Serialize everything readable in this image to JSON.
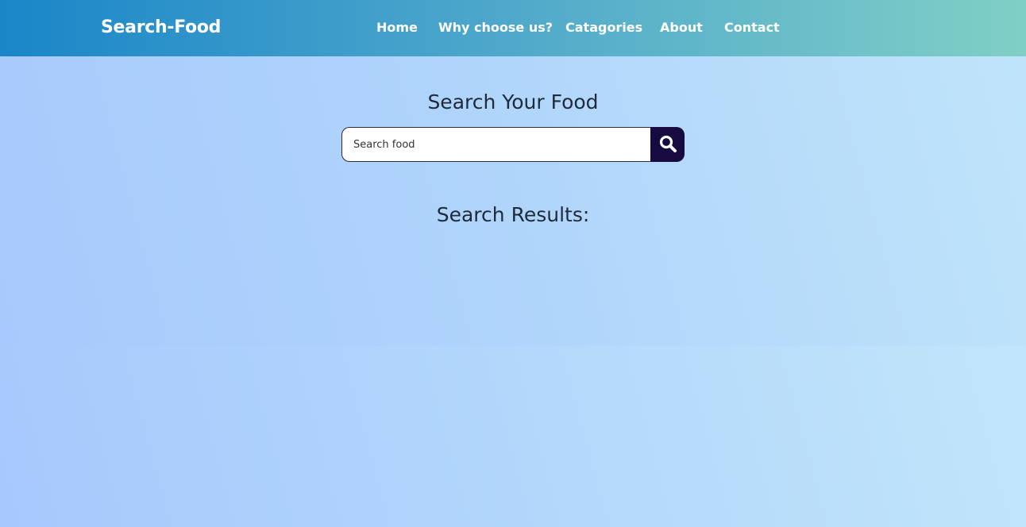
{
  "header": {
    "brand": "Search-Food",
    "nav": {
      "home": "Home",
      "why": "Why choose us?",
      "categories": "Catagories",
      "about": "About",
      "contact": "Contact"
    }
  },
  "search": {
    "title": "Search Your Food",
    "placeholder": "Search food",
    "value": "",
    "button_icon": "search-icon"
  },
  "results": {
    "title": "Search Results:",
    "items": []
  },
  "colors": {
    "button_bg": "#160a40",
    "text": "#1f2a3a",
    "nav_text": "#ffffff"
  }
}
